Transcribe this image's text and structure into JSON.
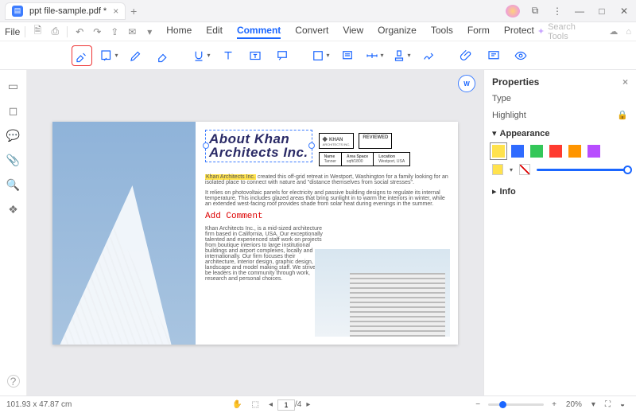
{
  "titlebar": {
    "tab_title": "ppt file-sample.pdf *"
  },
  "menubar": {
    "file": "File",
    "tabs": [
      "Home",
      "Edit",
      "Comment",
      "Convert",
      "View",
      "Organize",
      "Tools",
      "Form",
      "Protect"
    ],
    "active_index": 2,
    "search_placeholder": "Search Tools"
  },
  "properties": {
    "title": "Properties",
    "type_label": "Type",
    "type_value": "Highlight",
    "appearance_label": "Appearance",
    "info_label": "Info",
    "colors": [
      "#ffe24d",
      "#2f6bff",
      "#34c759",
      "#ff3b30",
      "#ff9500",
      "#b84dff"
    ],
    "selected_color_index": 0
  },
  "doc": {
    "heading_l1": "About Khan",
    "heading_l2": "Architects Inc.",
    "stamp_khan": "KHAN",
    "stamp_khan_sub": "ARCHITECTS INC.",
    "stamp_reviewed": "REVIEWED",
    "table_h": [
      "Name",
      "Area Space",
      "Location"
    ],
    "table_v": [
      "Tanner",
      "sqft/1800",
      "Westport, USA"
    ],
    "para1_hl": "Khan Architects Inc.",
    "para1": " created this off-grid retreat in Westport, Washington for a family looking for an isolated place to connect with nature and \"distance themselves from social stresses\".",
    "para2": "It relies on photovoltaic panels for electricity and passive building designs to regulate its internal temperature. This includes glazed areas that bring sunlight in to warm the interiors in winter, while an extended west-facing roof provides shade from solar heat during evenings in the summer.",
    "add_comment": "Add Comment",
    "para3": "Khan Architects Inc., is a mid-sized architecture firm based in California, USA. Our exceptionally talented and experienced staff work on projects from boutique interiors to large institutional buildings and airport complexes, locally and internationally. Our firm focuses their architecture, interior design, graphic design, landscape and model making staff. We strive to be leaders in the community through work, research and personal choices."
  },
  "status": {
    "coords": "101.93 x 47.87 cm",
    "page_current": "1",
    "page_total": "/4",
    "zoom": "20%"
  }
}
